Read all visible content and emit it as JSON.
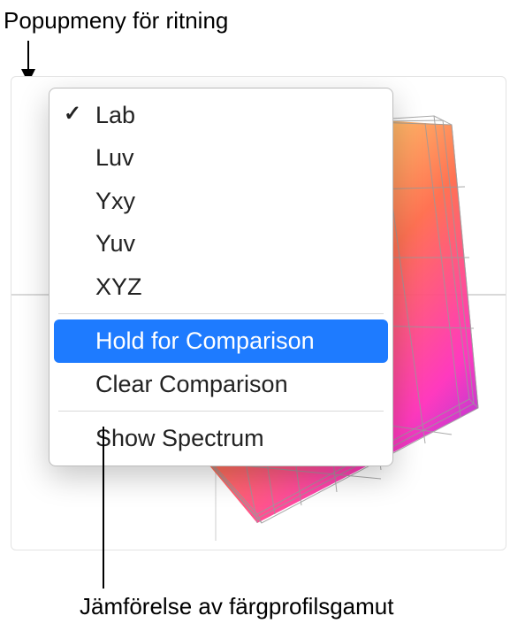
{
  "labels": {
    "top": "Popupmeny för ritning",
    "bottom": "Jämförelse av färgprofilsgamut"
  },
  "menu": {
    "items": [
      {
        "label": "Lab",
        "checked": true
      },
      {
        "label": "Luv",
        "checked": false
      },
      {
        "label": "Yxy",
        "checked": false
      },
      {
        "label": "Yuv",
        "checked": false
      },
      {
        "label": "XYZ",
        "checked": false
      }
    ],
    "actions": [
      {
        "label": "Hold for Comparison",
        "highlighted": true
      },
      {
        "label": "Clear Comparison",
        "highlighted": false
      }
    ],
    "extras": [
      {
        "label": "Show Spectrum"
      }
    ]
  }
}
